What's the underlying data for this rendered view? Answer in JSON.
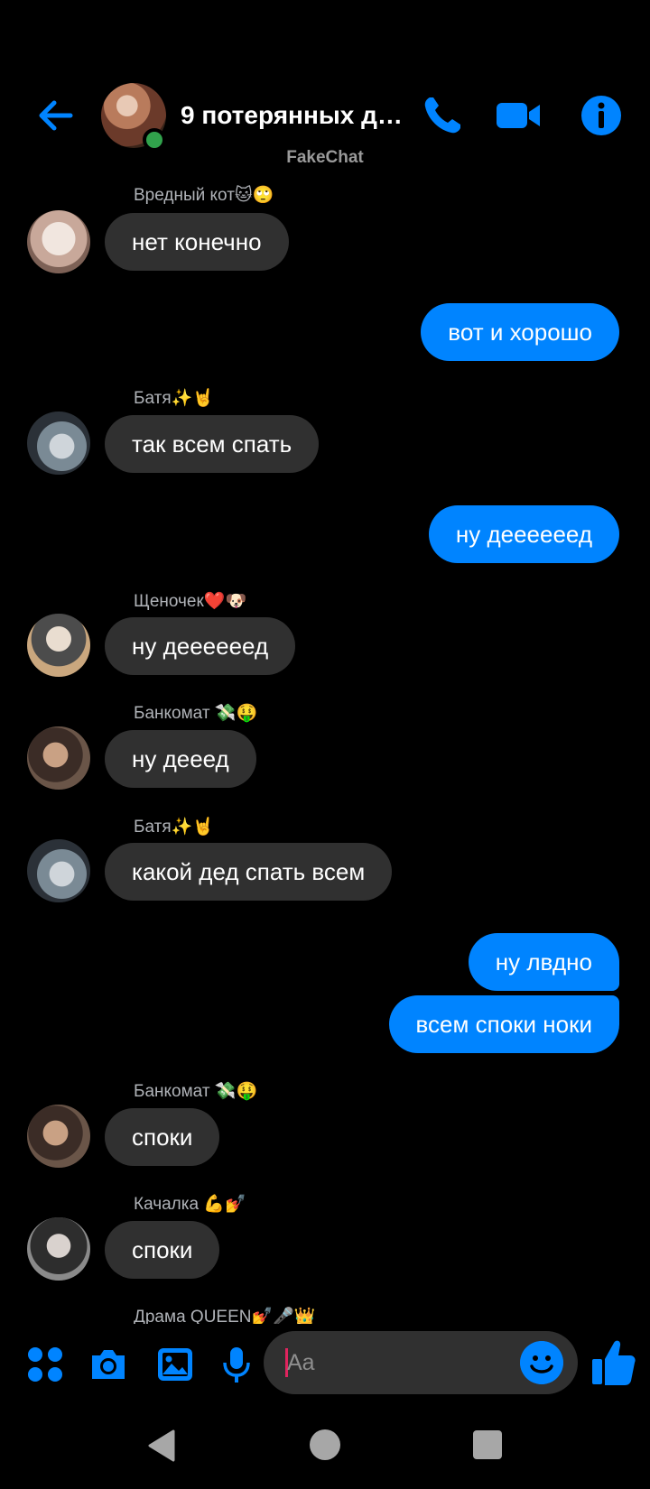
{
  "header": {
    "title": "9 потерянных де...",
    "subtitle": "FakeChat",
    "icons": [
      "back-arrow-icon",
      "phone-icon",
      "video-camera-icon",
      "info-icon"
    ]
  },
  "accent_color": "#0084ff",
  "messages": [
    {
      "sender": "Вредный кот🐱🙄",
      "text": "нет конечно",
      "direction": "incoming"
    },
    {
      "text": "вот и хорошо",
      "direction": "outgoing"
    },
    {
      "sender": "Батя✨🤘",
      "text": "так всем спать",
      "direction": "incoming"
    },
    {
      "text": "ну деееееед",
      "direction": "outgoing"
    },
    {
      "sender": "Щеночек❤️🐶",
      "text": "ну деееееед",
      "direction": "incoming"
    },
    {
      "sender": "Банкомат 💸🤑",
      "text": "ну дееед",
      "direction": "incoming"
    },
    {
      "sender": "Батя✨🤘",
      "text": "какой дед спать всем",
      "direction": "incoming"
    },
    {
      "text": "ну лвдно",
      "direction": "outgoing"
    },
    {
      "text": "всем споки ноки",
      "direction": "outgoing"
    },
    {
      "sender": "Банкомат 💸🤑",
      "text": "споки",
      "direction": "incoming"
    },
    {
      "sender": "Качалка 💪💅",
      "text": "споки",
      "direction": "incoming"
    },
    {
      "sender": "Драма QUEEN💅🎤👑",
      "direction": "incoming"
    }
  ],
  "composer": {
    "placeholder": "Aa",
    "icons": [
      "apps-icon",
      "camera-icon",
      "gallery-icon",
      "microphone-icon",
      "emoji-icon",
      "thumbs-up-icon"
    ]
  },
  "navbar": {
    "icons": [
      "nav-back-icon",
      "nav-home-icon",
      "nav-recents-icon"
    ]
  }
}
